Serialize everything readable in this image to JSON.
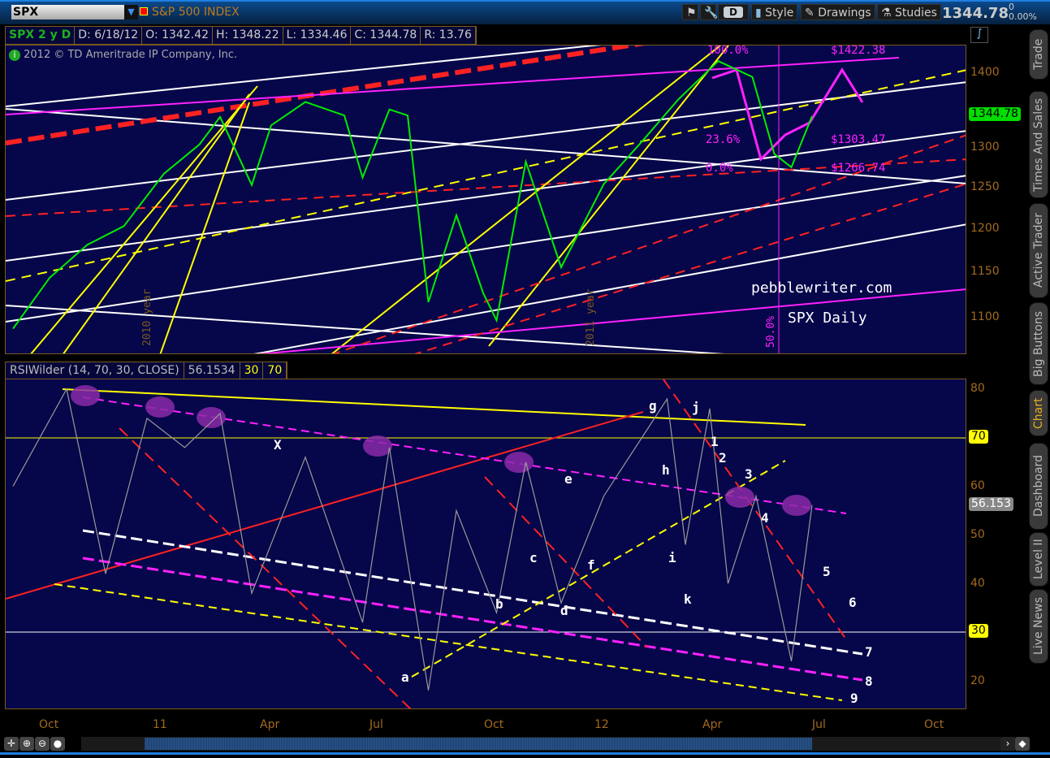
{
  "toolbar": {
    "symbol": "SPX",
    "symbol_name": "S&P 500 INDEX",
    "period_button": "D",
    "style_label": "Style",
    "drawings_label": "Drawings",
    "studies_label": "Studies",
    "last_price": "1344.78",
    "net_change": "0",
    "pct_change": "0.00%"
  },
  "header": {
    "title": "SPX 2 y D",
    "date": "D: 6/18/12",
    "open": "O: 1342.42",
    "high": "H: 1348.22",
    "low": "L: 1334.46",
    "close": "C: 1344.78",
    "range": "R: 13.76",
    "copyright": "2012 © TD Ameritrade IP Company, Inc."
  },
  "price_axis": {
    "ticks": [
      "1400",
      "1350",
      "1300",
      "1250",
      "1200",
      "1150",
      "1100"
    ],
    "current_tag": "1344.78"
  },
  "price_annotations": {
    "site": "pebblewriter.com",
    "chart_name": "SPX Daily",
    "fib_top": "$1422.38",
    "fib_mid": "$1303.47",
    "fib_low": "$1266.74",
    "pct_100": "100.0%",
    "pct_236": "23.6%",
    "pct_0": "0.0%",
    "pct_50": "50.0%",
    "year_2010": "2010 year",
    "year_2011": "2011 year"
  },
  "rsi": {
    "title": "RSIWilder (14, 70, 30, CLOSE)",
    "value": "56.1534",
    "lower": "30",
    "upper": "70",
    "ticks": [
      "80",
      "70",
      "60",
      "50",
      "40",
      "30",
      "20"
    ],
    "tag_70": "70",
    "tag_30": "30",
    "current_tag": "56.153",
    "labels": [
      "X",
      "a",
      "b",
      "c",
      "d",
      "e",
      "f",
      "g",
      "h",
      "i",
      "j",
      "k",
      "1",
      "2",
      "3",
      "4",
      "5",
      "6",
      "7",
      "8",
      "9"
    ]
  },
  "x_axis": {
    "ticks": [
      "Oct",
      "11",
      "Apr",
      "Jul",
      "Oct",
      "12",
      "Apr",
      "Jul",
      "Oct"
    ]
  },
  "sidebar": {
    "tabs": [
      "Trade",
      "Times And Sales",
      "Active Trader",
      "Big Buttons",
      "Chart",
      "Dashboard",
      "Level II",
      "Live News"
    ],
    "active": "Chart"
  },
  "colors": {
    "pane": "#06064a",
    "axis": "#a36a20",
    "up": "#00e000",
    "down": "#ff2020",
    "trend_yellow": "#ffff00",
    "trend_red": "#ff2020",
    "trend_white": "#ffffff",
    "magenta": "#ff20ff",
    "tag_green": "#00e000"
  },
  "chart_data": {
    "type": "line",
    "title": "SPX Daily",
    "price_series": [
      [
        "2010-09-01",
        1090
      ],
      [
        "2010-10-01",
        1146
      ],
      [
        "2010-11-01",
        1184
      ],
      [
        "2010-12-01",
        1206
      ],
      [
        "2011-01-03",
        1270
      ],
      [
        "2011-02-01",
        1307
      ],
      [
        "2011-02-18",
        1343
      ],
      [
        "2011-03-16",
        1256
      ],
      [
        "2011-04-01",
        1332
      ],
      [
        "2011-04-29",
        1363
      ],
      [
        "2011-05-31",
        1345
      ],
      [
        "2011-06-15",
        1265
      ],
      [
        "2011-07-07",
        1353
      ],
      [
        "2011-07-22",
        1345
      ],
      [
        "2011-08-08",
        1119
      ],
      [
        "2011-08-31",
        1219
      ],
      [
        "2011-09-22",
        1129
      ],
      [
        "2011-10-03",
        1099
      ],
      [
        "2011-10-27",
        1285
      ],
      [
        "2011-11-25",
        1158
      ],
      [
        "2011-12-30",
        1257
      ],
      [
        "2012-01-31",
        1312
      ],
      [
        "2012-02-29",
        1366
      ],
      [
        "2012-04-02",
        1419
      ],
      [
        "2012-04-30",
        1397
      ],
      [
        "2012-05-18",
        1295
      ],
      [
        "2012-06-01",
        1278
      ],
      [
        "2012-06-18",
        1344
      ]
    ],
    "rsi_series": [
      [
        "2010-09-01",
        60
      ],
      [
        "2010-10-15",
        80
      ],
      [
        "2010-11-16",
        42
      ],
      [
        "2010-12-20",
        74
      ],
      [
        "2011-01-20",
        68
      ],
      [
        "2011-02-18",
        75
      ],
      [
        "2011-03-16",
        38
      ],
      [
        "2011-04-29",
        66
      ],
      [
        "2011-06-15",
        32
      ],
      [
        "2011-07-07",
        68
      ],
      [
        "2011-08-08",
        18
      ],
      [
        "2011-08-31",
        55
      ],
      [
        "2011-10-03",
        34
      ],
      [
        "2011-10-27",
        65
      ],
      [
        "2011-11-25",
        36
      ],
      [
        "2011-12-30",
        58
      ],
      [
        "2012-02-20",
        78
      ],
      [
        "2012-03-06",
        48
      ],
      [
        "2012-03-26",
        76
      ],
      [
        "2012-04-10",
        40
      ],
      [
        "2012-05-03",
        58
      ],
      [
        "2012-06-01",
        24
      ],
      [
        "2012-06-18",
        56.15
      ]
    ],
    "ylim_price": [
      1060,
      1440
    ],
    "ylim_rsi": [
      15,
      85
    ]
  }
}
